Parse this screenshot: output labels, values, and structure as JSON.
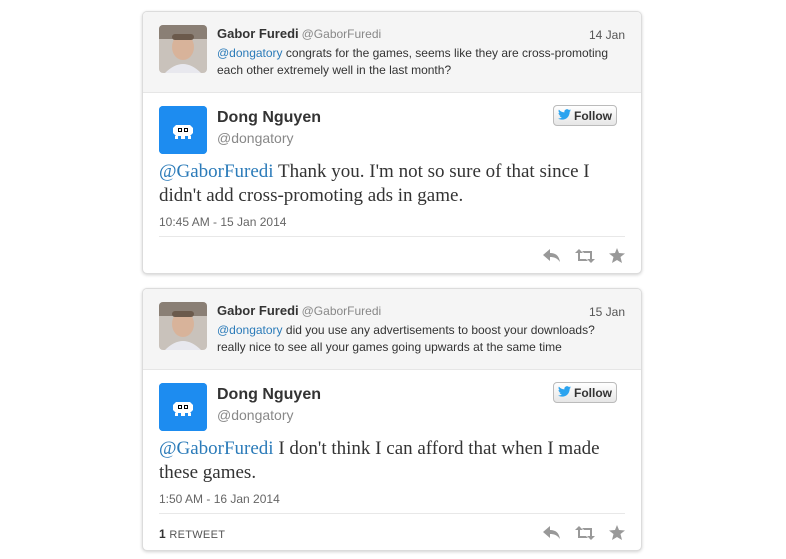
{
  "threads": [
    {
      "parent": {
        "name": "Gabor Furedi",
        "handle": "@GaborFuredi",
        "date": "14 Jan",
        "mention": "@dongatory",
        "text_line1": " congrats for the games, seems like they are cross-promoting",
        "text_line2": "each other extremely well in the last month?"
      },
      "reply": {
        "name": "Dong Nguyen",
        "handle": "@dongatory",
        "follow_label": "Follow",
        "mention": "@GaborFuredi",
        "text_line1": " Thank you. I'm not so sure of that since I",
        "text_line2": "didn't add cross-promoting ads in game.",
        "time": "10:45 AM - 15 Jan 2014"
      }
    },
    {
      "parent": {
        "name": "Gabor Furedi",
        "handle": "@GaborFuredi",
        "date": "15 Jan",
        "mention": "@dongatory",
        "text_line1": " did you use any advertisements to boost your downloads?",
        "text_line2": "really nice to see all your games going upwards at the same time"
      },
      "reply": {
        "name": "Dong Nguyen",
        "handle": "@dongatory",
        "follow_label": "Follow",
        "mention": "@GaborFuredi",
        "text_line1": " I don't think I can afford that when I made",
        "text_line2": "these games.",
        "time": "1:50 AM - 16 Jan 2014",
        "retweet_count": "1",
        "retweet_label": "RETWEET"
      }
    }
  ],
  "colors": {
    "link": "#2b7bb9",
    "twitter_blue": "#1d8cf0",
    "avatar_blue": "#1d8cf0"
  },
  "icons": [
    "reply-icon",
    "retweet-icon",
    "favorite-icon",
    "twitter-bird-icon"
  ]
}
